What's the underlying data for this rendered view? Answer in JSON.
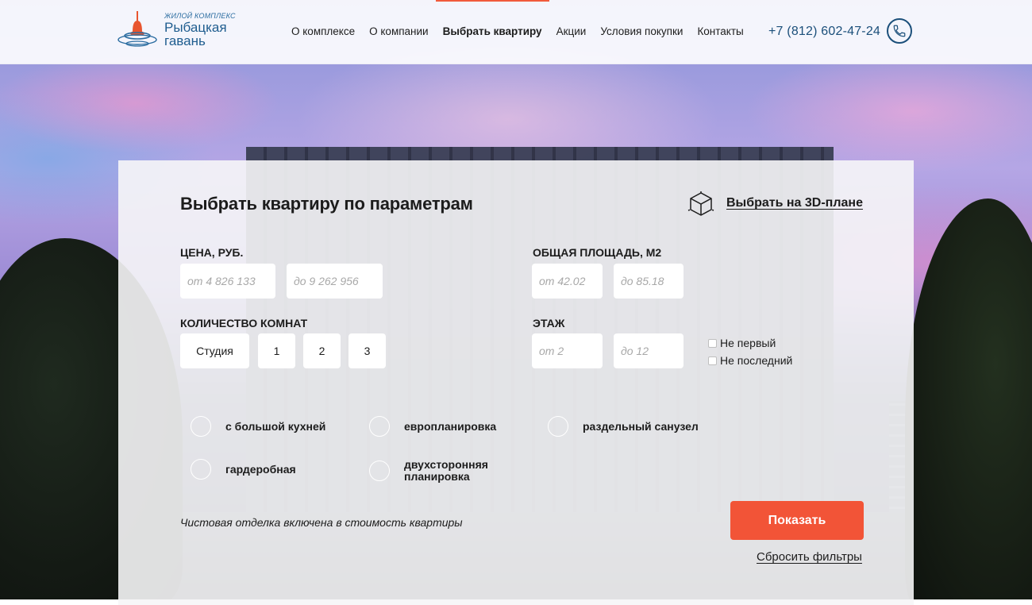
{
  "header": {
    "logo": {
      "subtitle": "ЖИЛОЙ КОМПЛЕКС",
      "name": "Рыбацкая гавань"
    },
    "nav": [
      {
        "label": "О комплексе",
        "active": false
      },
      {
        "label": "О компании",
        "active": false
      },
      {
        "label": "Выбрать квартиру",
        "active": true
      },
      {
        "label": "Акции",
        "active": false
      },
      {
        "label": "Условия покупки",
        "active": false
      },
      {
        "label": "Контакты",
        "active": false
      }
    ],
    "phone": "+7 (812) 602-47-24",
    "phone_icon": "phone-icon"
  },
  "filter": {
    "title": "Выбрать квартиру по параметрам",
    "plan3d_label": "Выбрать на 3D-плане",
    "plan3d_icon": "cube-icon",
    "price": {
      "label": "Цена, руб.",
      "from_placeholder": "от 4 826 133",
      "to_placeholder": "до 9 262 956"
    },
    "area": {
      "label": "Общая площадь, м2",
      "from_placeholder": "от 42.02",
      "to_placeholder": "до 85.18"
    },
    "rooms": {
      "label": "Количество комнат",
      "options": [
        "Студия",
        "1",
        "2",
        "3"
      ]
    },
    "floor": {
      "label": "Этаж",
      "from_placeholder": "от 2",
      "to_placeholder": "до 12",
      "not_first": "Не первый",
      "not_last": "Не последний"
    },
    "features": [
      "с большой кухней",
      "европланировка",
      "раздельный санузел",
      "гардеробная",
      "двухсторонняя планировка"
    ],
    "note": "Чистовая отделка включена в стоимость квартиры",
    "submit": "Показать",
    "reset": "Сбросить фильтры"
  },
  "colors": {
    "accent": "#f25437",
    "brand": "#1b4f7a",
    "text": "#1c1c1c"
  }
}
